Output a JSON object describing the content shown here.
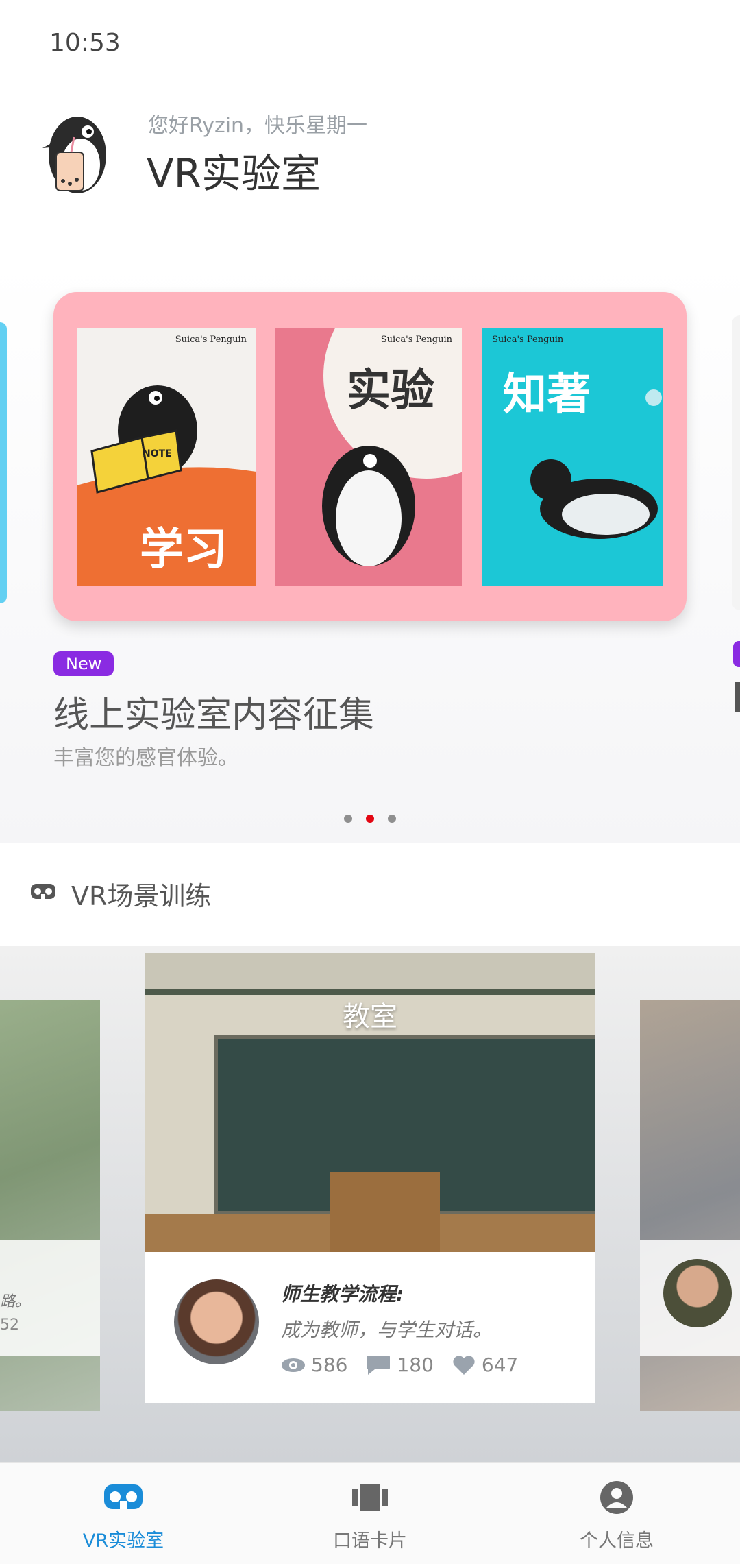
{
  "status_bar": {
    "time": "10:53"
  },
  "header": {
    "greeting": "您好Ryzin，快乐星期一",
    "title": "VR实验室"
  },
  "banner": {
    "books": [
      {
        "brand": "Suica's Penguin",
        "text": "学习",
        "note": "NOTE"
      },
      {
        "brand": "Suica's Penguin",
        "text": "实验"
      },
      {
        "brand": "Suica's Penguin",
        "text": "知著"
      }
    ],
    "badge": "New",
    "title": "线上实验室内容征集",
    "subtitle": "丰富您的感官体验。",
    "dots": 3,
    "active_dot": 1
  },
  "scene_section": {
    "title": "VR场景训练",
    "left_peek_lines": [
      "路。",
      "52"
    ],
    "cards": [
      {
        "label": "教室",
        "info_title": "师生教学流程:",
        "info_desc": "成为教师，与学生对话。",
        "views": "586",
        "comments": "180",
        "likes": "647"
      }
    ]
  },
  "tabbar": {
    "tabs": [
      {
        "label": "VR实验室",
        "icon": "vr-headset-icon",
        "active": true
      },
      {
        "label": "口语卡片",
        "icon": "cards-icon",
        "active": false
      },
      {
        "label": "个人信息",
        "icon": "user-icon",
        "active": false
      }
    ]
  },
  "colors": {
    "accent": "#1a8cd8",
    "badge": "#8a2be2",
    "banner_bg": "#ffb3bd",
    "active_dot": "#e30613"
  }
}
